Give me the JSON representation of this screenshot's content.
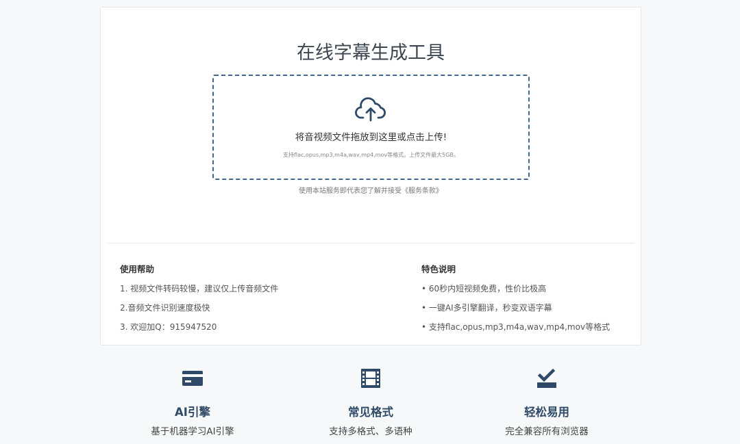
{
  "upload_card": {
    "title": "在线字幕生成工具",
    "dropzone": {
      "icon": "cloud-upload-icon",
      "main_text": "将音视频文件拖放到这里或点击上传!",
      "hint_text": "支持flac,opus,mp3,m4a,wav,mp4,mov等格式，上传文件最大5GB。"
    },
    "terms_text": "使用本站服务即代表您了解并接受《服务条款》"
  },
  "help": {
    "title": "使用帮助",
    "items": [
      "1. 视频文件转码较慢，建议仅上传音频文件",
      "2.音频文件识别速度极快",
      "3. 欢迎加Q：915947520"
    ]
  },
  "features_note": {
    "title": "特色说明",
    "items": [
      "• 60秒内短视频免费，性价比极高",
      "• 一键AI多引擎翻译，秒变双语字幕",
      "• 支持flac,opus,mp3,m4a,wav,mp4,mov等格式"
    ]
  },
  "features": [
    {
      "icon": "card-icon",
      "title": "AI引擎",
      "desc": "基于机器学习AI引擎"
    },
    {
      "icon": "film-icon",
      "title": "常见格式",
      "desc": "支持多格式、多语种"
    },
    {
      "icon": "check-tray-icon",
      "title": "轻松易用",
      "desc": "完全兼容所有浏览器"
    }
  ],
  "colors": {
    "accent": "#2f4a68",
    "dropzone_border": "#3e6790",
    "background": "#f7f8f9"
  }
}
